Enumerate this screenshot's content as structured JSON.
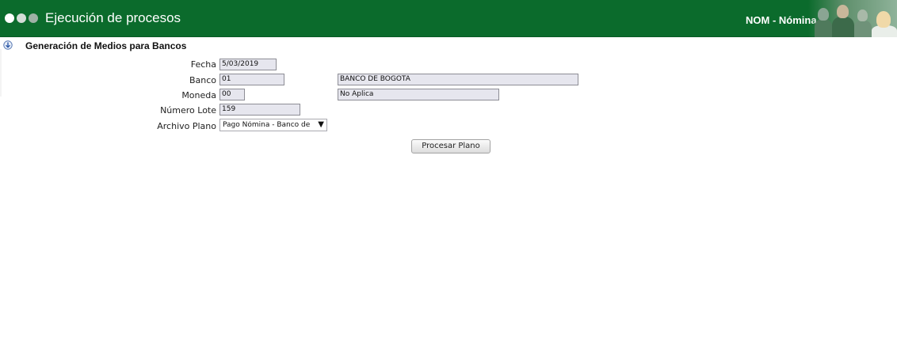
{
  "header": {
    "title": "Ejecución de procesos",
    "module": "NOM - Nómina",
    "colors": {
      "bar": "#0b6b2c",
      "text": "#ffffff"
    }
  },
  "section": {
    "title": "Generación de Medios para Bancos",
    "icon": "info-arrow-icon"
  },
  "form": {
    "fecha": {
      "label": "Fecha",
      "value": "5/03/2019"
    },
    "banco": {
      "label": "Banco",
      "code": "01",
      "name": "BANCO DE BOGOTA"
    },
    "moneda": {
      "label": "Moneda",
      "code": "00",
      "name": "No Aplica"
    },
    "numero_lote": {
      "label": "Número Lote",
      "value": "159"
    },
    "archivo_plano": {
      "label": "Archivo Plano",
      "selected": "Pago Nómina - Banco de Bogota"
    }
  },
  "actions": {
    "procesar_label": "Procesar Plano"
  }
}
